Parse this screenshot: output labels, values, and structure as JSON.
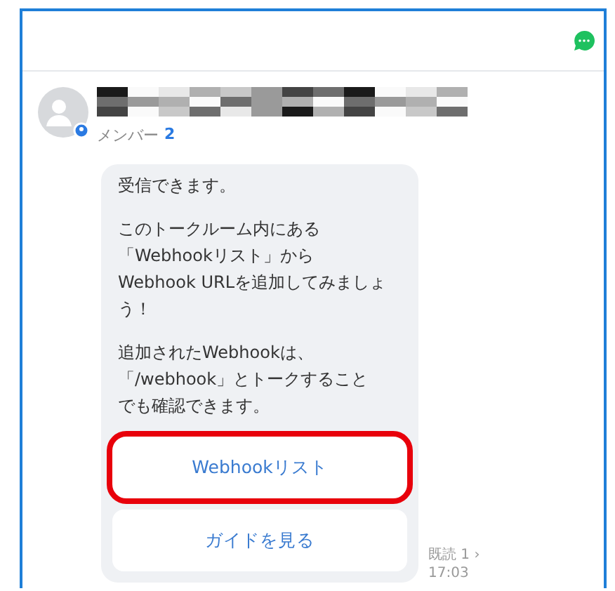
{
  "room": {
    "member_label": "メンバー",
    "member_count": "2"
  },
  "message": {
    "paragraphs": [
      [
        "受信できます。"
      ],
      [
        "このトークルーム内にある",
        "「Webhookリスト」から",
        "Webhook URLを追加してみましょう！"
      ],
      [
        "追加されたWebhookは、",
        "「/webhook」とトークすること",
        "でも確認できます。"
      ]
    ],
    "buttons": [
      {
        "label": "Webhookリスト",
        "highlighted": true
      },
      {
        "label": "ガイドを見る",
        "highlighted": false
      }
    ],
    "read_receipt": "既読 1 ›",
    "time": "17:03"
  }
}
